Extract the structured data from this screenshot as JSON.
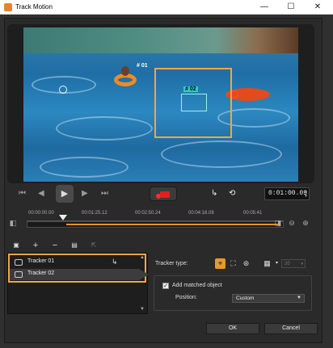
{
  "window": {
    "title": "Track Motion",
    "minimize_label": "—",
    "maximize_label": "☐",
    "close_label": "✕"
  },
  "video": {
    "tracker_tags": [
      "# 01",
      "# 02"
    ]
  },
  "playback": {
    "timecode": "0:01:00.09",
    "icons": [
      "home-icon",
      "step-back-icon",
      "play-icon",
      "step-forward-icon",
      "end-icon",
      "record-icon",
      "path-icon",
      "history-icon"
    ]
  },
  "timeline": {
    "ticks": [
      "00:00:00.00",
      "00:01:25.12",
      "00:02:50.24",
      "00:04:16.08",
      "00:05:41"
    ]
  },
  "tracker_toolbar": {
    "icons": [
      "tracker-list-icon",
      "add-icon",
      "remove-icon",
      "rename-icon",
      "export-icon"
    ]
  },
  "trackers": [
    {
      "label": "Tracker 01",
      "has_path": true
    },
    {
      "label": "Tracker 02",
      "has_path": false
    }
  ],
  "properties": {
    "tracker_type_label": "Tracker type:",
    "size_value": "20",
    "add_matched_label": "Add matched object",
    "add_matched_checked": true,
    "position_label": "Position:",
    "position_value": "Custom"
  },
  "buttons": {
    "ok": "OK",
    "cancel": "Cancel"
  },
  "colors": {
    "accent": "#e8922a",
    "tracker_box": "#f0a83a",
    "record": "#e32020"
  }
}
